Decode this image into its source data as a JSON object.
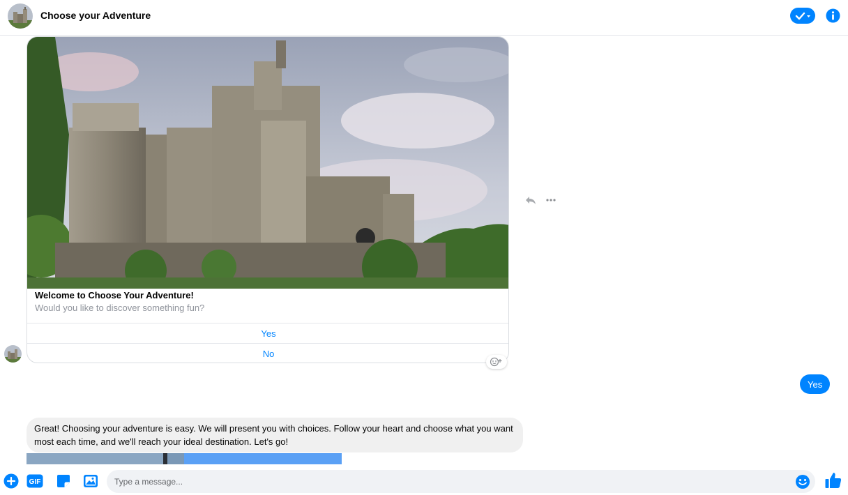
{
  "header": {
    "title": "Choose your Adventure"
  },
  "card": {
    "title": "Welcome to Choose Your Adventure!",
    "subtitle": "Would you like to discover something fun?",
    "buttons": [
      {
        "label": "Yes"
      },
      {
        "label": "No"
      }
    ]
  },
  "messages": {
    "outgoing": "Yes",
    "incoming": "Great! Choosing your adventure is easy. We will present you with choices. Follow your heart and choose what you want most each time, and we'll reach your ideal destination. Let's go!"
  },
  "composer": {
    "placeholder": "Type a message...",
    "gif_label": "GIF"
  },
  "colors": {
    "accent": "#0084ff",
    "bubble_gray": "#f0f0f0",
    "subtitle_gray": "#90949c"
  },
  "icons": [
    "castle-avatar",
    "check-menu-icon",
    "info-icon",
    "reply-icon",
    "more-icon",
    "add-reaction-icon",
    "plus-icon",
    "gif-icon",
    "sticker-icon",
    "image-icon",
    "emoji-icon",
    "thumbs-up-icon"
  ]
}
